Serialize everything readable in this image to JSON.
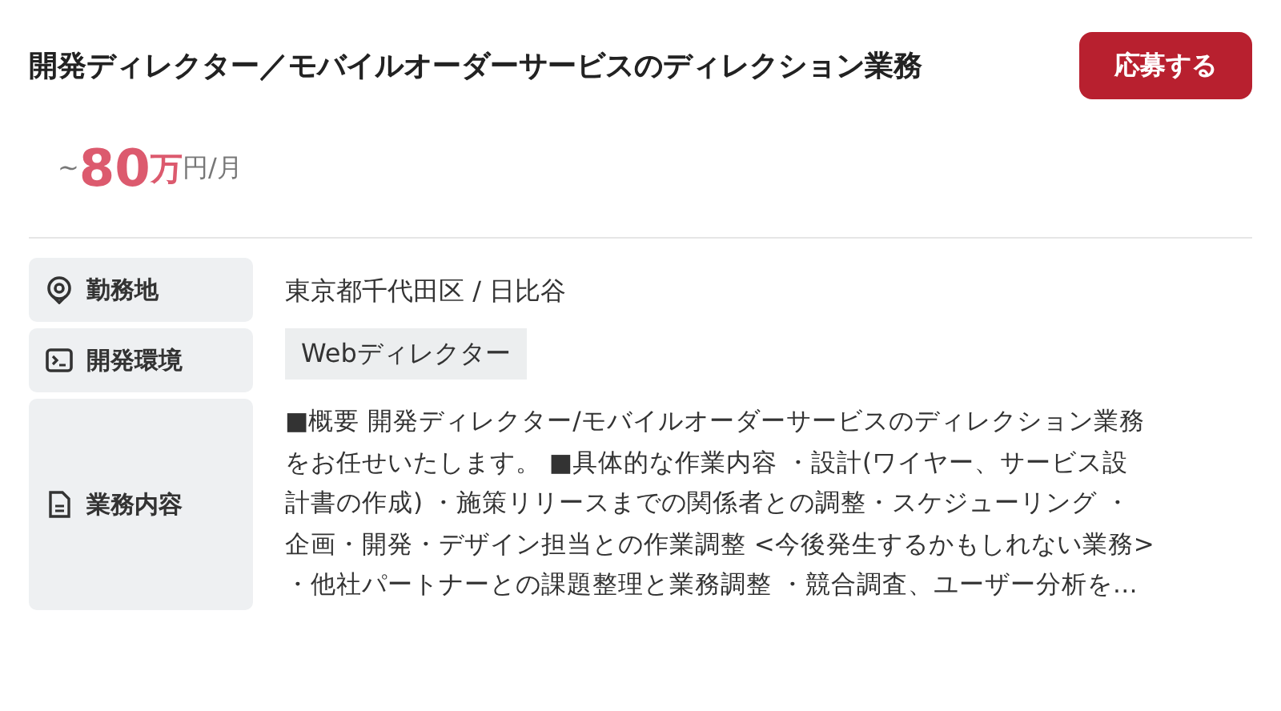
{
  "job": {
    "title": "開発ディレクター／モバイルオーダーサービスのディレクション業務",
    "apply_button": "応募する",
    "salary": {
      "prefix": "~",
      "amount": "80",
      "unit": "万",
      "suffix": "円/月"
    },
    "details": [
      {
        "kind": "text",
        "label": "勤務地",
        "value": "東京都千代田区 / 日比谷"
      },
      {
        "kind": "tags",
        "label": "開発環境",
        "tags": [
          "Webディレクター"
        ]
      },
      {
        "kind": "paragraph",
        "label": "業務内容",
        "lines": [
          "■概要 開発ディレクター/モバイルオーダーサービスのディレクション業務",
          "をお任せいたします。 ■具体的な作業内容 ・設計(ワイヤー、サービス設",
          "計書の作成) ・施策リリースまでの関係者との調整・スケジューリング ・",
          "企画・開発・デザイン担当との作業調整 <今後発生するかもしれない業務>",
          "・他社パートナーとの課題整理と業務調整 ・競合調査、ユーザー分析を…"
        ]
      }
    ]
  }
}
